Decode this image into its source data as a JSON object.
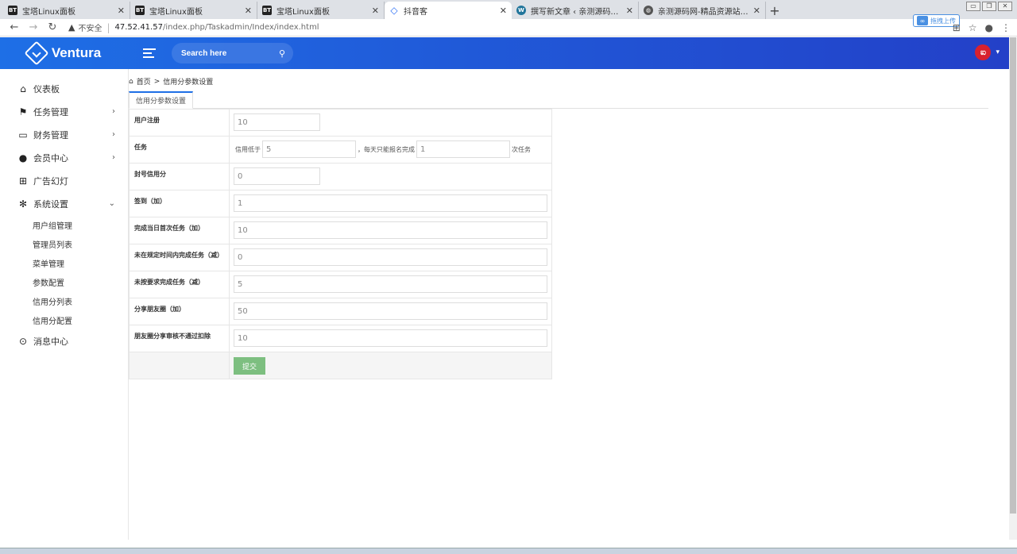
{
  "browser": {
    "tabs": [
      {
        "title": "宝塔Linux面板",
        "icon": "BT",
        "active": false
      },
      {
        "title": "宝塔Linux面板",
        "icon": "BT",
        "active": false
      },
      {
        "title": "宝塔Linux面板",
        "icon": "BT",
        "active": false
      },
      {
        "title": "抖音客",
        "icon": "diamond",
        "active": true
      },
      {
        "title": "撰写新文章 ‹ 亲测源码网 — Wo",
        "icon": "wp",
        "active": false
      },
      {
        "title": "亲测源码网-精品资源站长亲测",
        "icon": "globe",
        "active": false
      }
    ],
    "new_tab": "+",
    "security_label": "不安全",
    "url_host": "47.52.41.57",
    "url_path": "/index.php/Taskadmin/Index/index.html",
    "upload_label": "拖拽上传"
  },
  "header": {
    "brand": "Ventura",
    "search_placeholder": "Search here",
    "avatar_letter": "ಐ"
  },
  "sidebar": {
    "items": [
      {
        "label": "仪表板",
        "icon": "home-icon",
        "arrow": ""
      },
      {
        "label": "任务管理",
        "icon": "flag-icon",
        "arrow": "›"
      },
      {
        "label": "财务管理",
        "icon": "wallet-icon",
        "arrow": "›"
      },
      {
        "label": "会员中心",
        "icon": "user-icon",
        "arrow": "›"
      },
      {
        "label": "广告幻灯",
        "icon": "grid-icon",
        "arrow": ""
      },
      {
        "label": "系统设置",
        "icon": "gear-icon",
        "arrow": "⌄"
      }
    ],
    "subitems": [
      "用户组管理",
      "管理员列表",
      "菜单管理",
      "参数配置",
      "信用分列表",
      "信用分配置"
    ],
    "last_item": {
      "label": "消息中心",
      "icon": "chat-icon"
    }
  },
  "breadcrumb": {
    "home": "首页",
    "sep": ">",
    "current": "信用分参数设置"
  },
  "page_tab": "信用分参数设置",
  "form": {
    "rows": [
      {
        "label": "用户注册",
        "value": "10",
        "size": "short"
      },
      {
        "label": "任务",
        "type": "task"
      },
      {
        "label": "封号信用分",
        "value": "0",
        "size": "short"
      },
      {
        "label": "签到（加）",
        "value": "1",
        "size": "long"
      },
      {
        "label": "完成当日首次任务（加）",
        "value": "10",
        "size": "long"
      },
      {
        "label": "未在规定时间内完成任务（减）",
        "value": "0",
        "size": "long"
      },
      {
        "label": "未按要求完成任务（减）",
        "value": "5",
        "size": "long"
      },
      {
        "label": "分享朋友圈（加）",
        "value": "50",
        "size": "long"
      },
      {
        "label": "朋友圈分享审核不通过扣除",
        "value": "10",
        "size": "long"
      }
    ],
    "task": {
      "prefix": "信用低于",
      "credit_value": "5",
      "middle": "，每天只能报名完成",
      "count_value": "1",
      "suffix": "次任务"
    },
    "submit_label": "提交"
  }
}
